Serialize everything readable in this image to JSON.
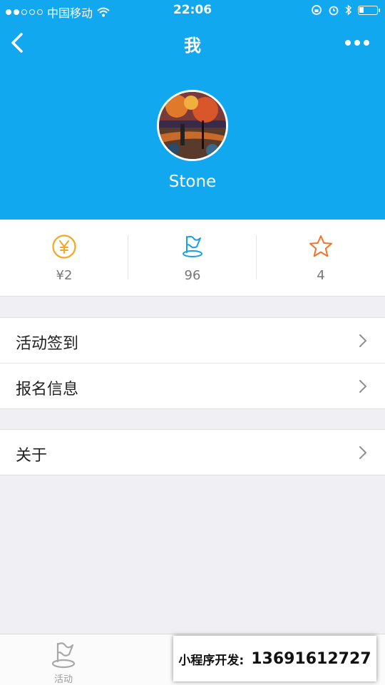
{
  "status_bar": {
    "carrier": "中国移动",
    "time": "22:06"
  },
  "nav": {
    "title": "我"
  },
  "profile": {
    "username": "Stone"
  },
  "stats": [
    {
      "icon": "yen-coin-icon",
      "value": "¥2",
      "color": "#f5a623"
    },
    {
      "icon": "flag-icon",
      "value": "96",
      "color": "#1a9ee6"
    },
    {
      "icon": "star-icon",
      "value": "4",
      "color": "#f0742b"
    }
  ],
  "menu": {
    "group1": [
      {
        "label": "活动签到"
      },
      {
        "label": "报名信息"
      }
    ],
    "group2": [
      {
        "label": "关于"
      }
    ]
  },
  "tabbar": {
    "activity_label": "活动"
  },
  "promo": {
    "label": "小程序开发:",
    "phone": "13691612727"
  },
  "colors": {
    "header": "#12a8f0",
    "page_bg": "#efeff4"
  }
}
